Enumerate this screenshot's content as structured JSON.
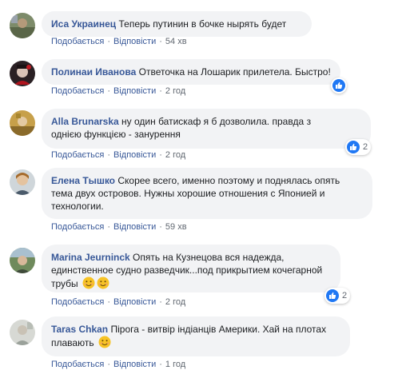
{
  "actions": {
    "like": "Подобається",
    "reply": "Відповісти",
    "sep": "·"
  },
  "comments": [
    {
      "author": "Иса Украинец",
      "text": "Теперь путинин в бочке нырять будет",
      "time": "54 хв"
    },
    {
      "author": "Полинаи Иванова",
      "text": "Ответочка на Лошарик прилетела. Быстро!",
      "time": "2 год"
    },
    {
      "author": "Alla Brunarska",
      "text": "ну один батискаф я б дозволила. правда з",
      "text2": "однією функцією - занурення",
      "time": "2 год",
      "reactions": "2"
    },
    {
      "author": "Елена Тышко",
      "text": "Скорее всего, именно поэтому и поднялась опять",
      "text2": "тема двух островов. Нужны хорошие отношения с Японией и",
      "text3": "технологии.",
      "time": "59 хв"
    },
    {
      "author": "Marina Jeurninck",
      "text": "Опять на Кузнецова вся надежда,",
      "text2": "единственное судно разведчик...под прикрытием кочегарной",
      "text3": "трубы",
      "time": "2 год",
      "reactions": "2"
    },
    {
      "author": "Taras Chkan",
      "text": "Пірога - витвір індіанців Америки. Хай на плотах",
      "text2": "плавають",
      "time": "1 год"
    }
  ],
  "icons": {
    "like": "thumbs-up-icon",
    "emoji": "smiling-face-icon"
  },
  "colors": {
    "author": "#385898",
    "bubble": "#f2f3f5",
    "like": "#2078f4"
  }
}
